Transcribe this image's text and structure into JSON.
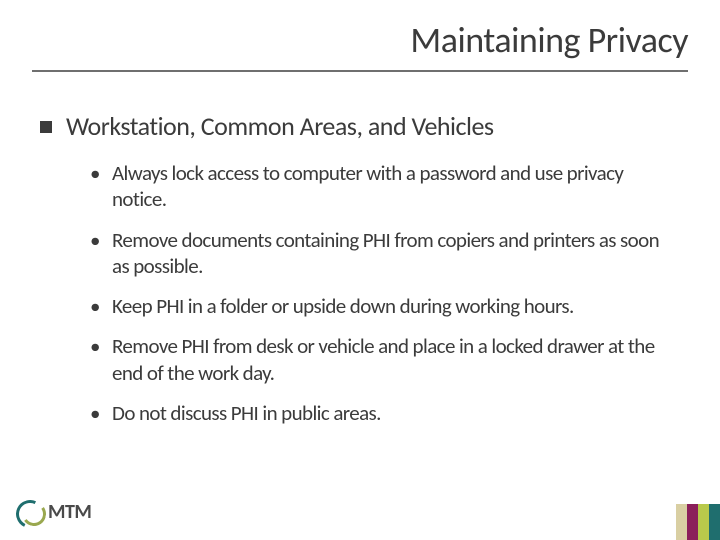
{
  "title": "Maintaining Privacy",
  "section": "Workstation, Common Areas, and Vehicles",
  "bullets": [
    "Always lock access to computer with a password and use privacy notice.",
    "Remove documents containing PHI from copiers and printers as soon as possible.",
    "Keep PHI in a folder or upside down during working hours.",
    "Remove PHI from desk or vehicle and place in a locked drawer at the end of the work day.",
    "Do not discuss PHI in public areas."
  ],
  "logo_text": "MTM",
  "bar_colors": [
    "#d9cfa3",
    "#8b1f5a",
    "#b8c94b",
    "#1f6e6e"
  ]
}
